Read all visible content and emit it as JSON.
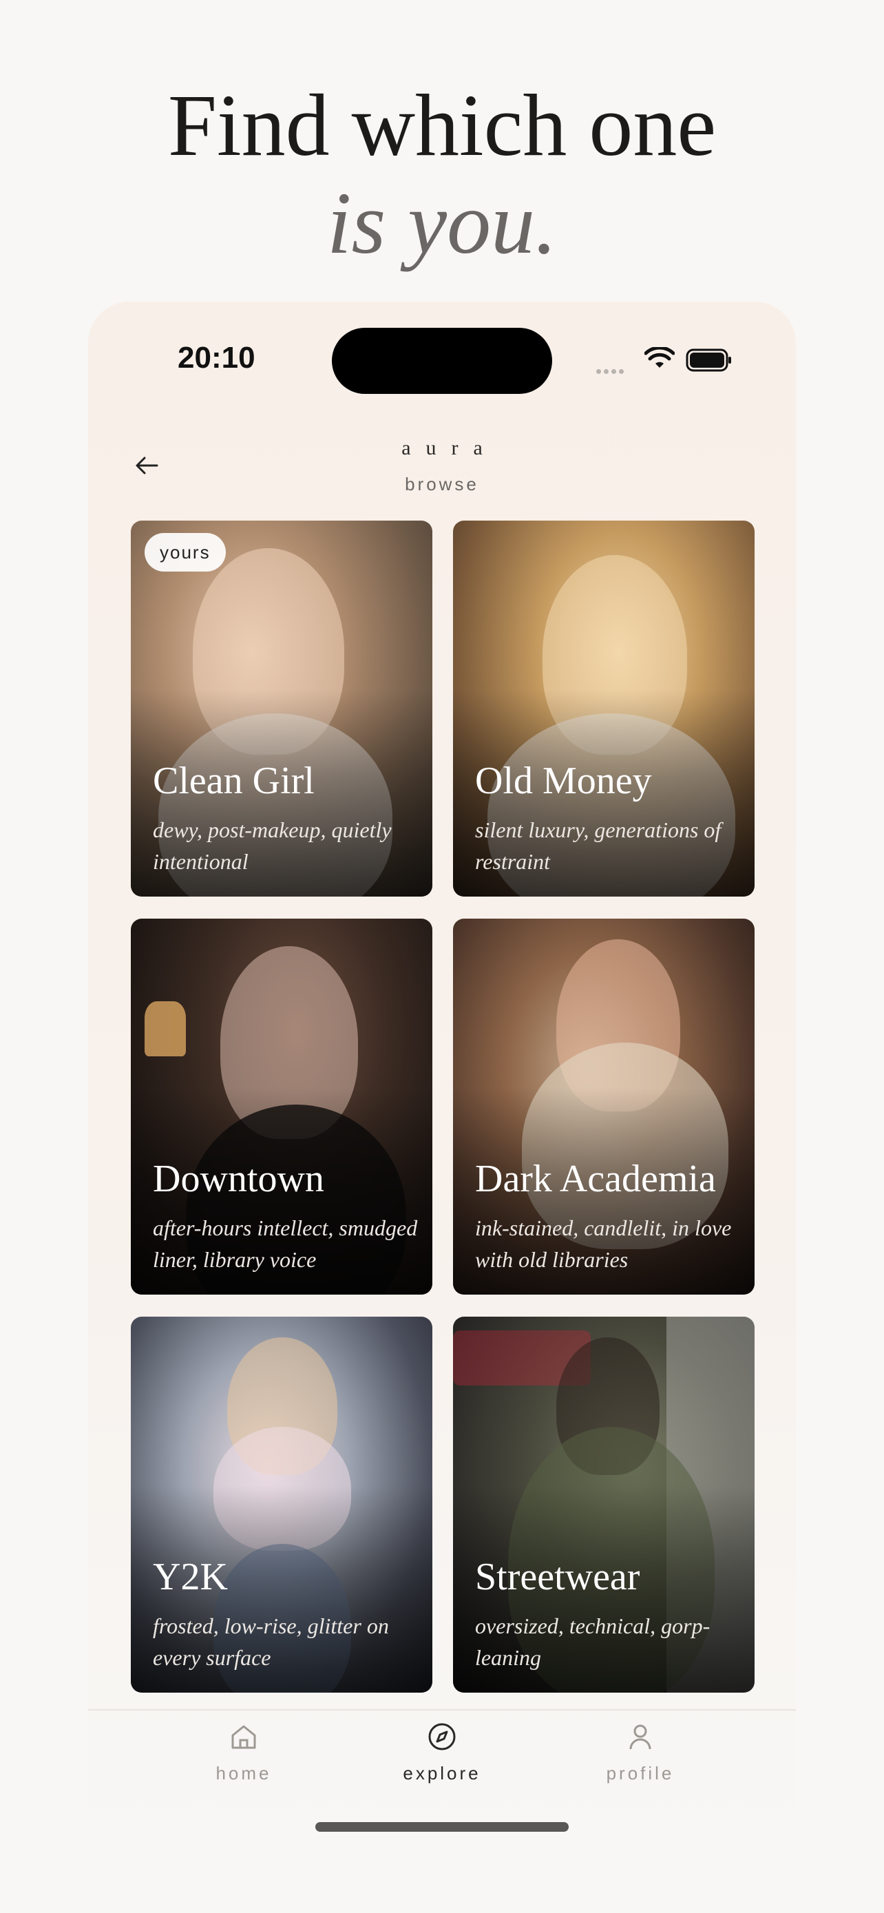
{
  "headline": {
    "line1": "Find which one",
    "line2": "is you."
  },
  "status_bar": {
    "time": "20:10"
  },
  "header": {
    "brand": "aura",
    "subtitle": "browse",
    "back_icon": "arrow-left-icon"
  },
  "cards": [
    {
      "title": "Clean Girl",
      "description": "dewy, post-makeup, quietly intentional",
      "badge": "yours"
    },
    {
      "title": "Old Money",
      "description": "silent luxury, generations of restraint"
    },
    {
      "title": "Downtown",
      "description": "after-hours intellect, smudged liner, library voice"
    },
    {
      "title": "Dark Academia",
      "description": "ink-stained, candlelit, in love with old libraries"
    },
    {
      "title": "Y2K",
      "description": "frosted, low-rise, glitter on every surface"
    },
    {
      "title": "Streetwear",
      "description": "oversized, technical, gorp-leaning"
    }
  ],
  "tab_bar": {
    "items": [
      {
        "label": "home",
        "icon": "home-icon"
      },
      {
        "label": "explore",
        "icon": "compass-icon",
        "active": true
      },
      {
        "label": "profile",
        "icon": "person-icon"
      }
    ]
  }
}
